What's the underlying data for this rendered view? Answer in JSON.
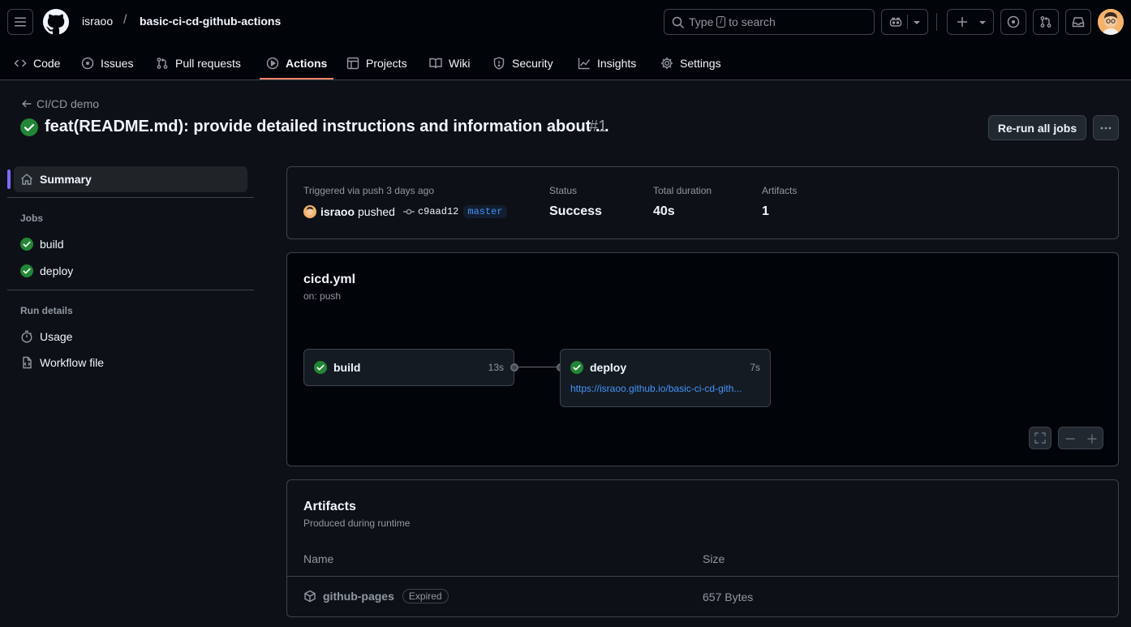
{
  "header": {
    "repo_owner": "israoo",
    "repo_separator": "/",
    "repo_name": "basic-ci-cd-github-actions",
    "search_prefix": "Type",
    "search_key": "/",
    "search_suffix": "to search"
  },
  "nav": {
    "items": [
      {
        "label": "Code",
        "icon": "code-icon"
      },
      {
        "label": "Issues",
        "icon": "issue-icon"
      },
      {
        "label": "Pull requests",
        "icon": "pull-request-icon"
      },
      {
        "label": "Actions",
        "icon": "play-icon",
        "active": true
      },
      {
        "label": "Projects",
        "icon": "table-icon"
      },
      {
        "label": "Wiki",
        "icon": "book-icon"
      },
      {
        "label": "Security",
        "icon": "shield-icon"
      },
      {
        "label": "Insights",
        "icon": "graph-icon"
      },
      {
        "label": "Settings",
        "icon": "gear-icon"
      }
    ]
  },
  "run": {
    "back_label": "CI/CD demo",
    "title": "feat(README.md): provide detailed instructions and information about ...",
    "number": "#1",
    "rerun_label": "Re-run all jobs"
  },
  "sidebar": {
    "summary_label": "Summary",
    "jobs_heading": "Jobs",
    "jobs": [
      {
        "label": "build"
      },
      {
        "label": "deploy"
      }
    ],
    "run_details_heading": "Run details",
    "details": [
      {
        "label": "Usage",
        "icon": "stopwatch-icon"
      },
      {
        "label": "Workflow file",
        "icon": "file-code-icon"
      }
    ]
  },
  "summary": {
    "triggered_label": "Triggered via push 3 days ago",
    "actor": "israoo",
    "action": "pushed",
    "commit": "c9aad12",
    "branch": "master",
    "status_label": "Status",
    "status_value": "Success",
    "duration_label": "Total duration",
    "duration_value": "40s",
    "artifacts_label": "Artifacts",
    "artifacts_value": "1"
  },
  "workflow": {
    "file": "cicd.yml",
    "trigger": "on: push",
    "jobs": [
      {
        "name": "build",
        "duration": "13s"
      },
      {
        "name": "deploy",
        "duration": "7s",
        "url": "https://israoo.github.io/basic-ci-cd-gith..."
      }
    ]
  },
  "artifacts": {
    "title": "Artifacts",
    "subtitle": "Produced during runtime",
    "col_name": "Name",
    "col_size": "Size",
    "rows": [
      {
        "name": "github-pages",
        "badge": "Expired",
        "size": "657 Bytes"
      }
    ]
  },
  "colors": {
    "success": "#238636",
    "accent": "#f78166",
    "link": "#4493f8"
  }
}
